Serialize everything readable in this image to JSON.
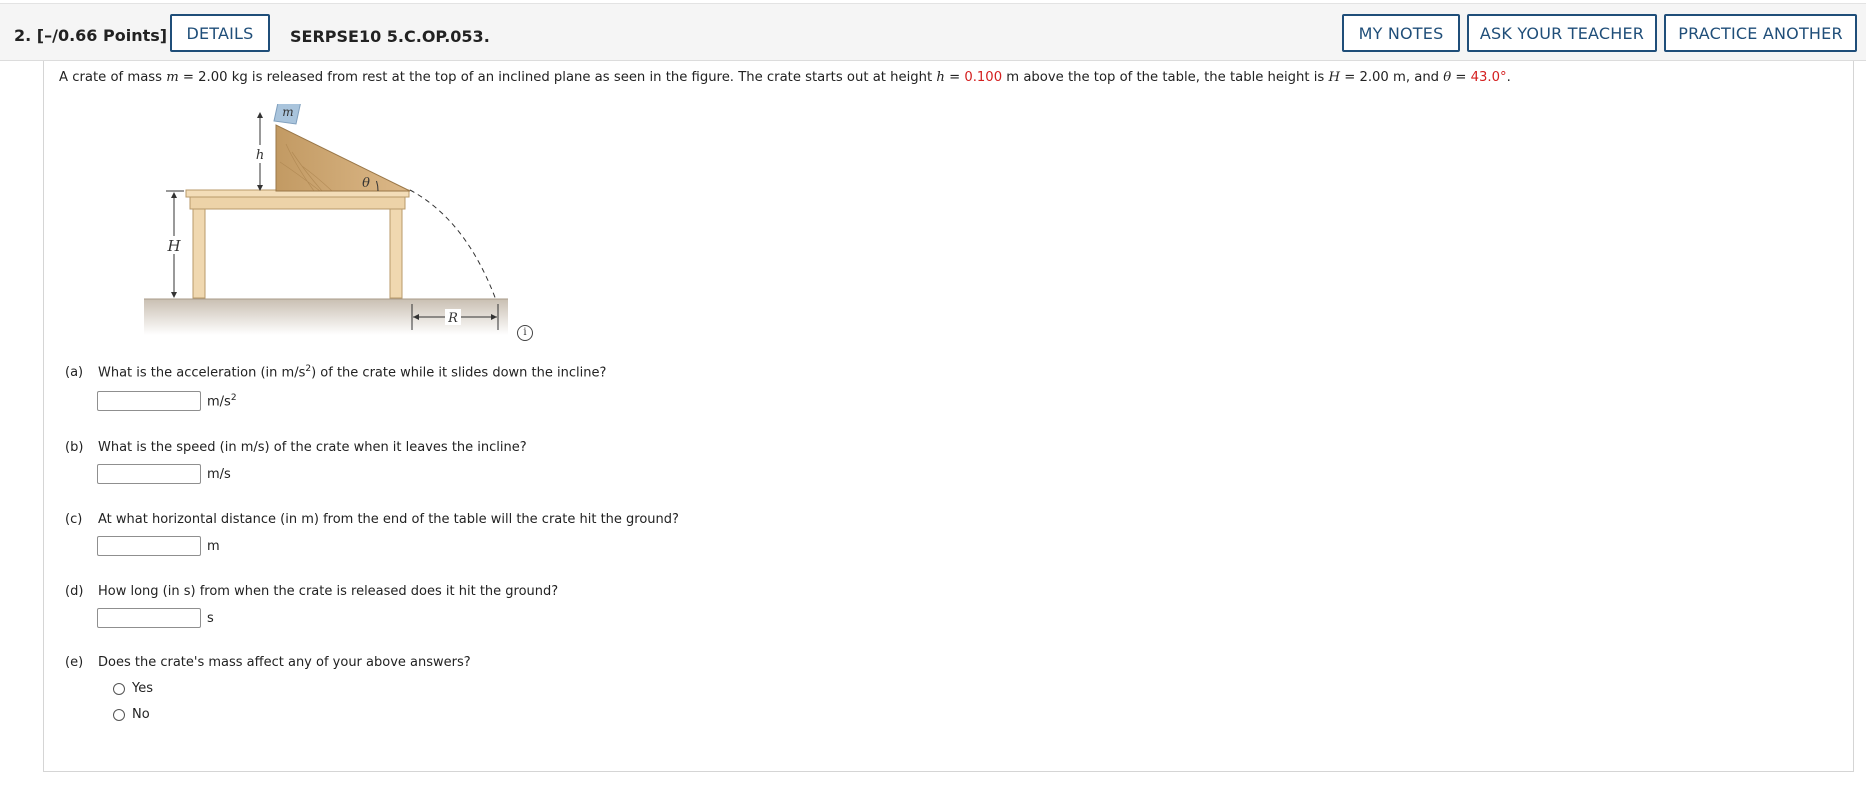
{
  "header": {
    "question_number": "2.  [–/0.66 Points]",
    "details_label": "DETAILS",
    "problem_code": "SERPSE10 5.C.OP.053.",
    "my_notes_label": "MY NOTES",
    "ask_teacher_label": "ASK YOUR TEACHER",
    "practice_label": "PRACTICE ANOTHER"
  },
  "problem": {
    "text1": "A crate of mass ",
    "m_var": "m",
    "text2": " = 2.00 kg is released from rest at the top of an inclined plane as seen in the figure. The crate starts out at height ",
    "h_var": "h",
    "text3": " = ",
    "h_value": "0.100",
    "text4": " m above the top of the table, the table height is ",
    "H_var": "H",
    "text5": " = 2.00 m, and ",
    "theta_var": "θ",
    "text6": " = ",
    "theta_value": "43.0°",
    "text7": "."
  },
  "figure": {
    "label_m": "m",
    "label_h": "h",
    "label_H": "H",
    "label_theta": "θ",
    "label_R": "R",
    "info_symbol": "i"
  },
  "parts": {
    "a": {
      "label": "(a)",
      "q1": "What is the acceleration (in m/s",
      "q_sup": "2",
      "q2": ") of the crate while it slides down the incline?",
      "unit": "m/s",
      "unit_sup": "2",
      "value": ""
    },
    "b": {
      "label": "(b)",
      "question": "What is the speed (in m/s) of the crate when it leaves the incline?",
      "unit": "m/s",
      "value": ""
    },
    "c": {
      "label": "(c)",
      "question": "At what horizontal distance (in m) from the end of the table will the crate hit the ground?",
      "unit": "m",
      "value": ""
    },
    "d": {
      "label": "(d)",
      "question": "How long (in s) from when the crate is released does it hit the ground?",
      "unit": "s",
      "value": ""
    },
    "e": {
      "label": "(e)",
      "question": "Does the crate's mass affect any of your above answers?",
      "options": [
        "Yes",
        "No"
      ]
    }
  }
}
